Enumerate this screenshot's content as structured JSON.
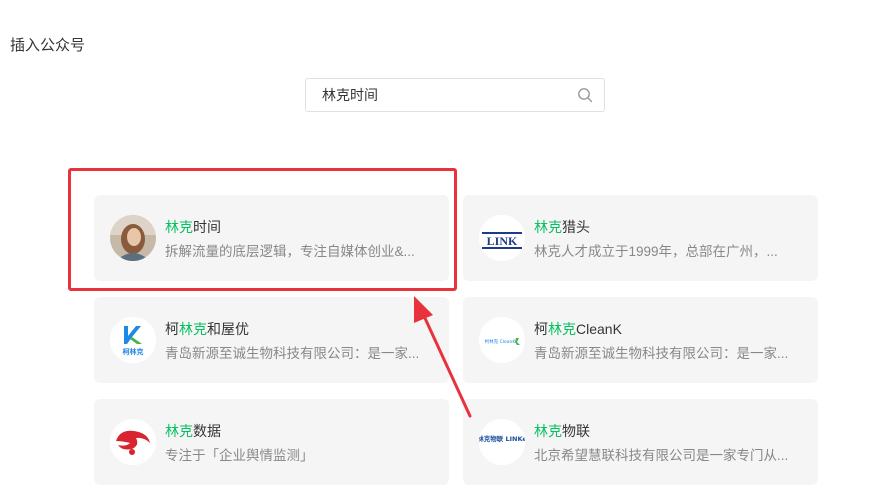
{
  "page": {
    "title": "插入公众号"
  },
  "search": {
    "value": "林克时间",
    "icon": "search-icon"
  },
  "accounts": [
    {
      "name_prefix": "",
      "name_highlight": "林克",
      "name_suffix": "时间",
      "desc": "拆解流量的底层逻辑，专注自媒体创业&...",
      "avatar": "person-photo"
    },
    {
      "name_prefix": "",
      "name_highlight": "林克",
      "name_suffix": "猎头",
      "desc": "林克人才成立于1999年，总部在广州，...",
      "avatar": "LINK",
      "avatar_logo_text": "LINK"
    },
    {
      "name_prefix": "柯",
      "name_highlight": "林克",
      "name_suffix": "和屋优",
      "desc": "青岛新源至诚生物科技有限公司：是一家...",
      "avatar": "kelinke-logo",
      "avatar_logo_text": "柯林克"
    },
    {
      "name_prefix": "柯",
      "name_highlight": "林克",
      "name_suffix": "CleanK",
      "desc": "青岛新源至诚生物科技有限公司：是一家...",
      "avatar": "cleank-logo",
      "avatar_logo_text": "柯林克 CleanK"
    },
    {
      "name_prefix": "",
      "name_highlight": "林克",
      "name_suffix": "数据",
      "desc": "专注于「企业舆情监测」",
      "avatar": "red-swirl-logo"
    },
    {
      "name_prefix": "",
      "name_highlight": "林克",
      "name_suffix": "物联",
      "desc": "北京希望慧联科技有限公司是一家专门从...",
      "avatar": "linke-iot-logo",
      "avatar_logo_text": "林克物联 LINKe"
    }
  ],
  "colors": {
    "highlight_text": "#07c160",
    "annotation": "#e8323c",
    "card_bg": "#f5f5f5"
  }
}
